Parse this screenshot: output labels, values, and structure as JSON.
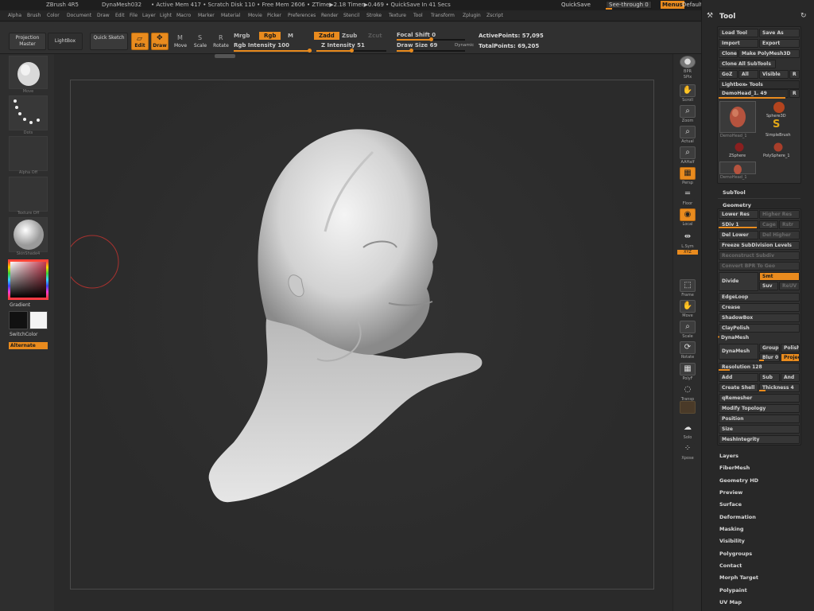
{
  "titlebar": {
    "app": "ZBrush 4R5",
    "document": "DynaMesh032",
    "stats": "• Active Mem 417 • Scratch Disk 110 • Free Mem 2606 • ZTime▶2.18 Timer▶0.469 • QuickSave In 41 Secs",
    "quicksave": "QuickSave",
    "seethrough": "See-through 0",
    "menus": "Menus",
    "script": "DefaultZScript"
  },
  "menubar": [
    "Alpha",
    "Brush",
    "Color",
    "Document",
    "Draw",
    "Edit",
    "File",
    "Layer",
    "Light",
    "Macro",
    "Marker",
    "Material",
    "Movie",
    "Picker",
    "Preferences",
    "Render",
    "Stencil",
    "Stroke",
    "Texture",
    "Tool",
    "Transform",
    "Zplugin",
    "Zscript"
  ],
  "topshelf": {
    "projection_master": "Projection Master",
    "lightbox": "LightBox",
    "quick_sketch": "Quick Sketch",
    "edit": "Edit",
    "draw": "Draw",
    "move": "Move",
    "scale": "Scale",
    "rotate": "Rotate",
    "mrgb": "Mrgb",
    "rgb": "Rgb",
    "m": "M",
    "rgb_intensity": "Rgb Intensity 100",
    "zadd": "Zadd",
    "zsub": "Zsub",
    "zcut": "Zcut",
    "z_intensity": "Z Intensity 51",
    "focal_shift": "Focal Shift 0",
    "draw_size": "Draw Size 69",
    "dynamic": "Dynamic",
    "active_points": "ActivePoints: 57,095",
    "total_points": "TotalPoints: 69,205"
  },
  "leftshelf": {
    "brush_label": "Move",
    "stroke_label": "Dots",
    "alpha_label": "Alpha Off",
    "texture_label": "Texture Off",
    "material_label": "SkinShade4",
    "gradient": "Gradient",
    "switchcolor": "SwitchColor",
    "alternate": "Alternate"
  },
  "rightshelf": [
    "BPR",
    "SPix",
    "Scroll",
    "Zoom",
    "Actual",
    "AAHalf",
    "Persp",
    "Floor",
    "Local",
    "L.Sym",
    "XYZ",
    "Frame",
    "Move",
    "Scale",
    "Rotate",
    "PolyF",
    "Transp",
    "Ghost",
    "Solo",
    "Xpose"
  ],
  "tool": {
    "title": "Tool",
    "load_tool": "Load Tool",
    "save_as": "Save As",
    "import": "Import",
    "export": "Export",
    "clone": "Clone",
    "make_polymesh": "Make PolyMesh3D",
    "clone_all": "Clone All SubTools",
    "goz": "GoZ",
    "all": "All",
    "visible": "Visible",
    "r": "R",
    "lightbox_tools": "Lightbox▸ Tools",
    "current_tool": "DemoHead_1. 49",
    "tools": [
      "DemoHead_1",
      "Sphere3D",
      "SimpleBrush",
      "ZSphere",
      "PolySphere_1",
      "DemoHead_1"
    ],
    "subtool": "SubTool",
    "geometry": "Geometry",
    "lower_res": "Lower Res",
    "higher_res": "Higher Res",
    "sdiv": "SDiv 1",
    "cage": "Cage",
    "rstr": "Rstr",
    "del_lower": "Del Lower",
    "del_higher": "Del Higher",
    "freeze": "Freeze SubDivision Levels",
    "reconstruct": "Reconstruct Subdiv",
    "convert": "Convert BPR To Geo",
    "divide": "Divide",
    "smt": "Smt",
    "suv": "Suv",
    "reuv": "ReUV",
    "edgeloop": "EdgeLoop",
    "crease": "Crease",
    "shadowbox": "ShadowBox",
    "claypolish": "ClayPolish",
    "dynamesh_header": "DynaMesh",
    "dynamesh": "DynaMesh",
    "group": "Group",
    "polish": "Polish",
    "blur": "Blur 0",
    "project": "Project",
    "resolution": "Resolution 128",
    "add": "Add",
    "sub": "Sub",
    "and": "And",
    "create_shell": "Create Shell",
    "thickness": "Thickness 4",
    "qremesher": "qRemesher",
    "modify_topology": "Modify Topology",
    "position": "Position",
    "size": "Size",
    "meshintegrity": "MeshIntegrity",
    "sections": [
      "Layers",
      "FiberMesh",
      "Geometry HD",
      "Preview",
      "Surface",
      "Deformation",
      "Masking",
      "Visibility",
      "Polygroups",
      "Contact",
      "Morph Target",
      "Polypaint",
      "UV Map"
    ]
  },
  "colors": {
    "accent": "#e98b1e",
    "panel": "#282828",
    "canvas": "#2b2b2b"
  }
}
